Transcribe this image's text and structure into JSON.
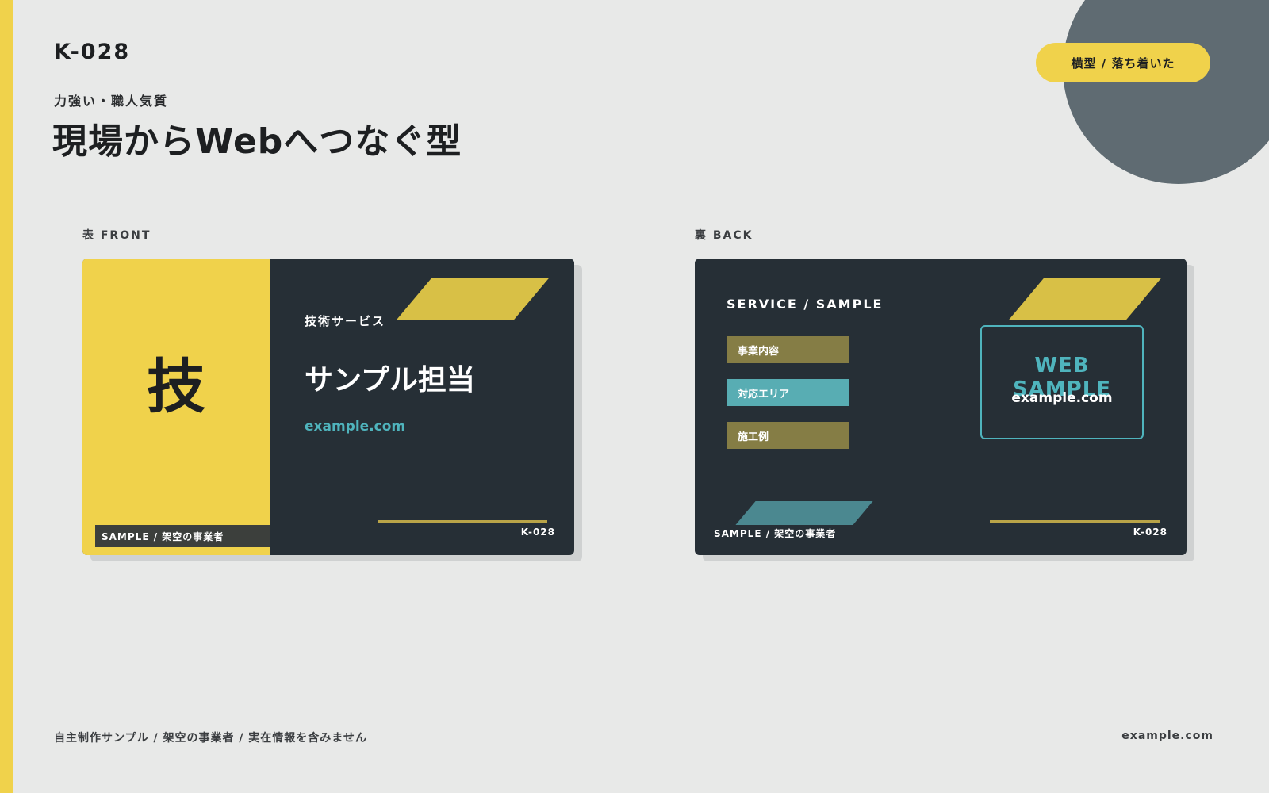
{
  "header": {
    "code": "K-028",
    "subtitle": "力強い・職人気質",
    "title": "現場からWebへつなぐ型",
    "badge": "横型 / 落ち着いた"
  },
  "front": {
    "label": "表 FRONT",
    "kanji": "技",
    "service": "技術サービス",
    "name": "サンプル担当",
    "url": "example.com",
    "sample_tag": "SAMPLE / 架空の事業者",
    "code": "K-028"
  },
  "back": {
    "label": "裏 BACK",
    "heading": "SERVICE / SAMPLE",
    "services": [
      {
        "label": "事業内容",
        "color": "#857d45"
      },
      {
        "label": "対応エリア",
        "color": "#58adb3"
      },
      {
        "label": "施工例",
        "color": "#857d45"
      }
    ],
    "web_title": "WEB SAMPLE",
    "web_url": "example.com",
    "sample_tag": "SAMPLE / 架空の事業者",
    "code": "K-028"
  },
  "footer": {
    "note": "自主制作サンプル / 架空の事業者 / 実在情報を含みません",
    "url": "example.com"
  },
  "colors": {
    "accent_yellow": "#f0d24b",
    "card_dark": "#262f36",
    "teal": "#4fb4bd",
    "circle_gray": "#5f6b72"
  }
}
